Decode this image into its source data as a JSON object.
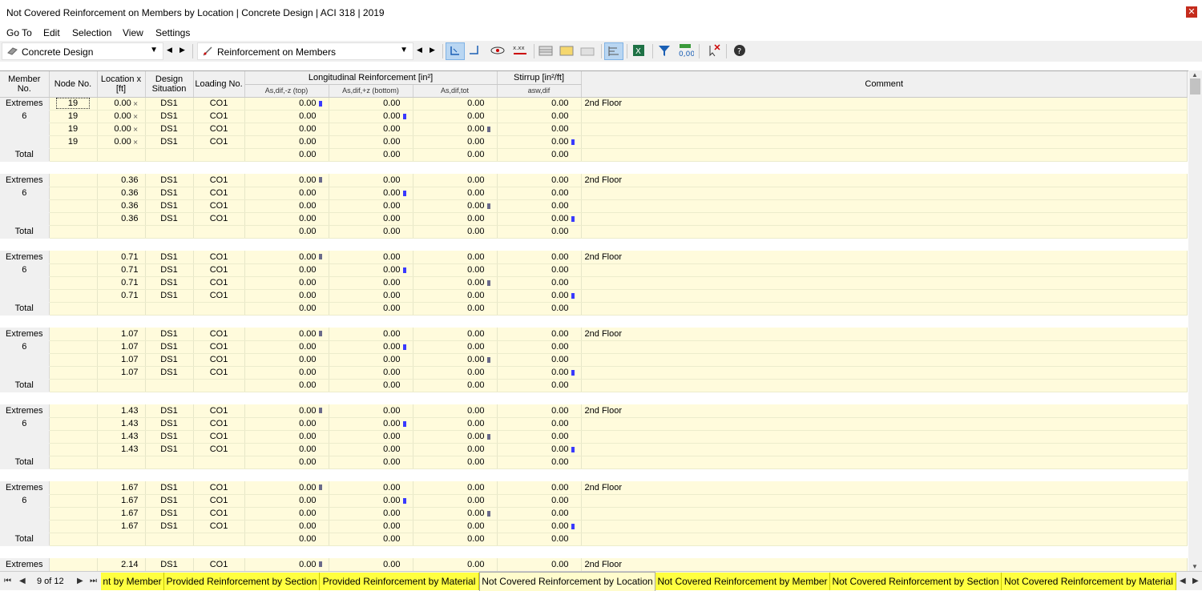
{
  "window": {
    "title": "Not Covered Reinforcement on Members by Location | Concrete Design | ACI 318 | 2019",
    "close_glyph": "✕"
  },
  "menu": [
    "Go To",
    "Edit",
    "Selection",
    "View",
    "Settings"
  ],
  "toolbar": {
    "module": "Concrete Design",
    "table": "Reinforcement on Members"
  },
  "headers": {
    "member": "Member No.",
    "node": "Node No.",
    "location": "Location x [ft]",
    "design": "Design Situation",
    "loading": "Loading No.",
    "long": "Longitudinal Reinforcement [in²]",
    "stirrup": "Stirrup [in²/ft]",
    "comment": "Comment",
    "top": "As,dif,-z (top)",
    "bottom": "As,dif,+z (bottom)",
    "tot": "As,dif,tot",
    "asw": "asw,dif"
  },
  "groups": [
    {
      "member_label": "Extremes",
      "member_no": "6",
      "comment": "2nd Floor",
      "rows": [
        {
          "node": "19",
          "loc": "0.00",
          "ds": "DS1",
          "co": "CO1",
          "top": "0.00",
          "bot": "0.00",
          "tot": "0.00",
          "asw": "0.00",
          "mk": 0
        },
        {
          "node": "19",
          "loc": "0.00",
          "ds": "DS1",
          "co": "CO1",
          "top": "0.00",
          "bot": "0.00",
          "tot": "0.00",
          "asw": "0.00",
          "mk": 1
        },
        {
          "node": "19",
          "loc": "0.00",
          "ds": "DS1",
          "co": "CO1",
          "top": "0.00",
          "bot": "0.00",
          "tot": "0.00",
          "asw": "0.00",
          "mk": 2
        },
        {
          "node": "19",
          "loc": "0.00",
          "ds": "DS1",
          "co": "CO1",
          "top": "0.00",
          "bot": "0.00",
          "tot": "0.00",
          "asw": "0.00",
          "mk": 3
        }
      ],
      "total": {
        "label": "Total",
        "top": "0.00",
        "bot": "0.00",
        "tot": "0.00",
        "asw": "0.00"
      }
    },
    {
      "member_label": "Extremes",
      "member_no": "6",
      "comment": "2nd Floor",
      "rows": [
        {
          "node": "",
          "loc": "0.36",
          "ds": "DS1",
          "co": "CO1",
          "top": "0.00",
          "bot": "0.00",
          "tot": "0.00",
          "asw": "0.00",
          "mk": 0
        },
        {
          "node": "",
          "loc": "0.36",
          "ds": "DS1",
          "co": "CO1",
          "top": "0.00",
          "bot": "0.00",
          "tot": "0.00",
          "asw": "0.00",
          "mk": 1
        },
        {
          "node": "",
          "loc": "0.36",
          "ds": "DS1",
          "co": "CO1",
          "top": "0.00",
          "bot": "0.00",
          "tot": "0.00",
          "asw": "0.00",
          "mk": 2
        },
        {
          "node": "",
          "loc": "0.36",
          "ds": "DS1",
          "co": "CO1",
          "top": "0.00",
          "bot": "0.00",
          "tot": "0.00",
          "asw": "0.00",
          "mk": 3
        }
      ],
      "total": {
        "label": "Total",
        "top": "0.00",
        "bot": "0.00",
        "tot": "0.00",
        "asw": "0.00"
      }
    },
    {
      "member_label": "Extremes",
      "member_no": "6",
      "comment": "2nd Floor",
      "rows": [
        {
          "node": "",
          "loc": "0.71",
          "ds": "DS1",
          "co": "CO1",
          "top": "0.00",
          "bot": "0.00",
          "tot": "0.00",
          "asw": "0.00",
          "mk": 0
        },
        {
          "node": "",
          "loc": "0.71",
          "ds": "DS1",
          "co": "CO1",
          "top": "0.00",
          "bot": "0.00",
          "tot": "0.00",
          "asw": "0.00",
          "mk": 1
        },
        {
          "node": "",
          "loc": "0.71",
          "ds": "DS1",
          "co": "CO1",
          "top": "0.00",
          "bot": "0.00",
          "tot": "0.00",
          "asw": "0.00",
          "mk": 2
        },
        {
          "node": "",
          "loc": "0.71",
          "ds": "DS1",
          "co": "CO1",
          "top": "0.00",
          "bot": "0.00",
          "tot": "0.00",
          "asw": "0.00",
          "mk": 3
        }
      ],
      "total": {
        "label": "Total",
        "top": "0.00",
        "bot": "0.00",
        "tot": "0.00",
        "asw": "0.00"
      }
    },
    {
      "member_label": "Extremes",
      "member_no": "6",
      "comment": "2nd Floor",
      "rows": [
        {
          "node": "",
          "loc": "1.07",
          "ds": "DS1",
          "co": "CO1",
          "top": "0.00",
          "bot": "0.00",
          "tot": "0.00",
          "asw": "0.00",
          "mk": 0
        },
        {
          "node": "",
          "loc": "1.07",
          "ds": "DS1",
          "co": "CO1",
          "top": "0.00",
          "bot": "0.00",
          "tot": "0.00",
          "asw": "0.00",
          "mk": 1
        },
        {
          "node": "",
          "loc": "1.07",
          "ds": "DS1",
          "co": "CO1",
          "top": "0.00",
          "bot": "0.00",
          "tot": "0.00",
          "asw": "0.00",
          "mk": 2
        },
        {
          "node": "",
          "loc": "1.07",
          "ds": "DS1",
          "co": "CO1",
          "top": "0.00",
          "bot": "0.00",
          "tot": "0.00",
          "asw": "0.00",
          "mk": 3
        }
      ],
      "total": {
        "label": "Total",
        "top": "0.00",
        "bot": "0.00",
        "tot": "0.00",
        "asw": "0.00"
      }
    },
    {
      "member_label": "Extremes",
      "member_no": "6",
      "comment": "2nd Floor",
      "rows": [
        {
          "node": "",
          "loc": "1.43",
          "ds": "DS1",
          "co": "CO1",
          "top": "0.00",
          "bot": "0.00",
          "tot": "0.00",
          "asw": "0.00",
          "mk": 0
        },
        {
          "node": "",
          "loc": "1.43",
          "ds": "DS1",
          "co": "CO1",
          "top": "0.00",
          "bot": "0.00",
          "tot": "0.00",
          "asw": "0.00",
          "mk": 1
        },
        {
          "node": "",
          "loc": "1.43",
          "ds": "DS1",
          "co": "CO1",
          "top": "0.00",
          "bot": "0.00",
          "tot": "0.00",
          "asw": "0.00",
          "mk": 2
        },
        {
          "node": "",
          "loc": "1.43",
          "ds": "DS1",
          "co": "CO1",
          "top": "0.00",
          "bot": "0.00",
          "tot": "0.00",
          "asw": "0.00",
          "mk": 3
        }
      ],
      "total": {
        "label": "Total",
        "top": "0.00",
        "bot": "0.00",
        "tot": "0.00",
        "asw": "0.00"
      }
    },
    {
      "member_label": "Extremes",
      "member_no": "6",
      "comment": "2nd Floor",
      "rows": [
        {
          "node": "",
          "loc": "1.67",
          "ds": "DS1",
          "co": "CO1",
          "top": "0.00",
          "bot": "0.00",
          "tot": "0.00",
          "asw": "0.00",
          "mk": 0
        },
        {
          "node": "",
          "loc": "1.67",
          "ds": "DS1",
          "co": "CO1",
          "top": "0.00",
          "bot": "0.00",
          "tot": "0.00",
          "asw": "0.00",
          "mk": 1
        },
        {
          "node": "",
          "loc": "1.67",
          "ds": "DS1",
          "co": "CO1",
          "top": "0.00",
          "bot": "0.00",
          "tot": "0.00",
          "asw": "0.00",
          "mk": 2
        },
        {
          "node": "",
          "loc": "1.67",
          "ds": "DS1",
          "co": "CO1",
          "top": "0.00",
          "bot": "0.00",
          "tot": "0.00",
          "asw": "0.00",
          "mk": 3
        }
      ],
      "total": {
        "label": "Total",
        "top": "0.00",
        "bot": "0.00",
        "tot": "0.00",
        "asw": "0.00"
      }
    },
    {
      "member_label": "Extremes",
      "member_no": "",
      "comment": "2nd Floor",
      "rows": [
        {
          "node": "",
          "loc": "2.14",
          "ds": "DS1",
          "co": "CO1",
          "top": "0.00",
          "bot": "0.00",
          "tot": "0.00",
          "asw": "0.00",
          "mk": 0
        }
      ],
      "total": null
    }
  ],
  "pager": {
    "text": "9 of 12"
  },
  "tabs": [
    {
      "label": "nt by Member",
      "active": false
    },
    {
      "label": "Provided Reinforcement by Section",
      "active": false
    },
    {
      "label": "Provided Reinforcement by Material",
      "active": false
    },
    {
      "label": "Not Covered Reinforcement by Location",
      "active": true
    },
    {
      "label": "Not Covered Reinforcement by Member",
      "active": false
    },
    {
      "label": "Not Covered Reinforcement by Section",
      "active": false
    },
    {
      "label": "Not Covered Reinforcement by Material",
      "active": false
    }
  ],
  "colors": {
    "row_bg": "#fffbdc",
    "tab_bg": "#ffff40",
    "marker_blue": "#3a3aff"
  }
}
